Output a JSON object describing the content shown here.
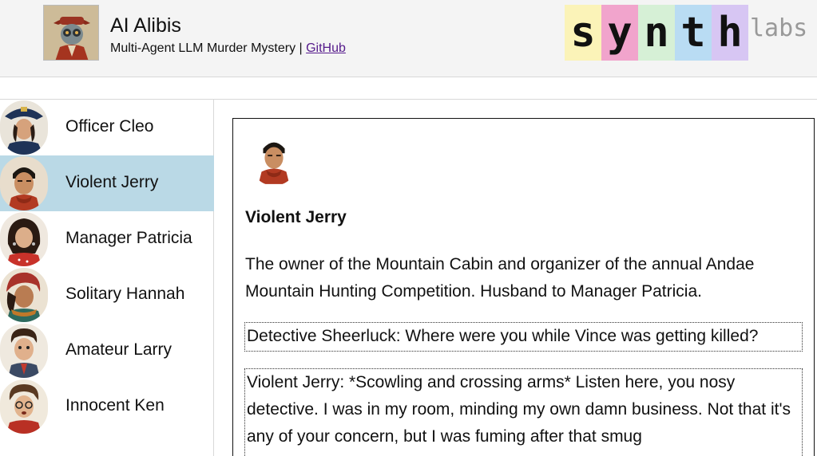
{
  "header": {
    "app_title": "AI Alibis",
    "subtitle": "Multi-Agent LLM Murder Mystery | ",
    "github_link": "GitHub",
    "brand_letters": [
      "s",
      "y",
      "n",
      "t",
      "h"
    ],
    "brand_colors": [
      "#fbf3b8",
      "#f1a4cc",
      "#d6f0d6",
      "#b9dcf3",
      "#d7c6f3"
    ],
    "brand_suffix": "labs"
  },
  "sidebar": {
    "items": [
      {
        "name": "Officer Cleo",
        "avatar": "officer-cleo-avatar",
        "active": false
      },
      {
        "name": "Violent Jerry",
        "avatar": "violent-jerry-avatar",
        "active": true
      },
      {
        "name": "Manager Patricia",
        "avatar": "manager-patricia-avatar",
        "active": false
      },
      {
        "name": "Solitary Hannah",
        "avatar": "solitary-hannah-avatar",
        "active": false
      },
      {
        "name": "Amateur Larry",
        "avatar": "amateur-larry-avatar",
        "active": false
      },
      {
        "name": "Innocent Ken",
        "avatar": "innocent-ken-avatar",
        "active": false
      }
    ],
    "active_color": "#bad9e6"
  },
  "main": {
    "character_name": "Violent Jerry",
    "description": "The owner of the Mountain Cabin and organizer of the annual Andae Mountain Hunting Competition. Husband to Manager Patricia.",
    "messages": [
      "Detective Sheerluck: Where were you while Vince was getting killed?",
      "Violent Jerry: *Scowling and crossing arms* Listen here, you nosy detective. I was in my room, minding my own damn business. Not that it's any of your concern, but I was fuming after that smug"
    ]
  }
}
